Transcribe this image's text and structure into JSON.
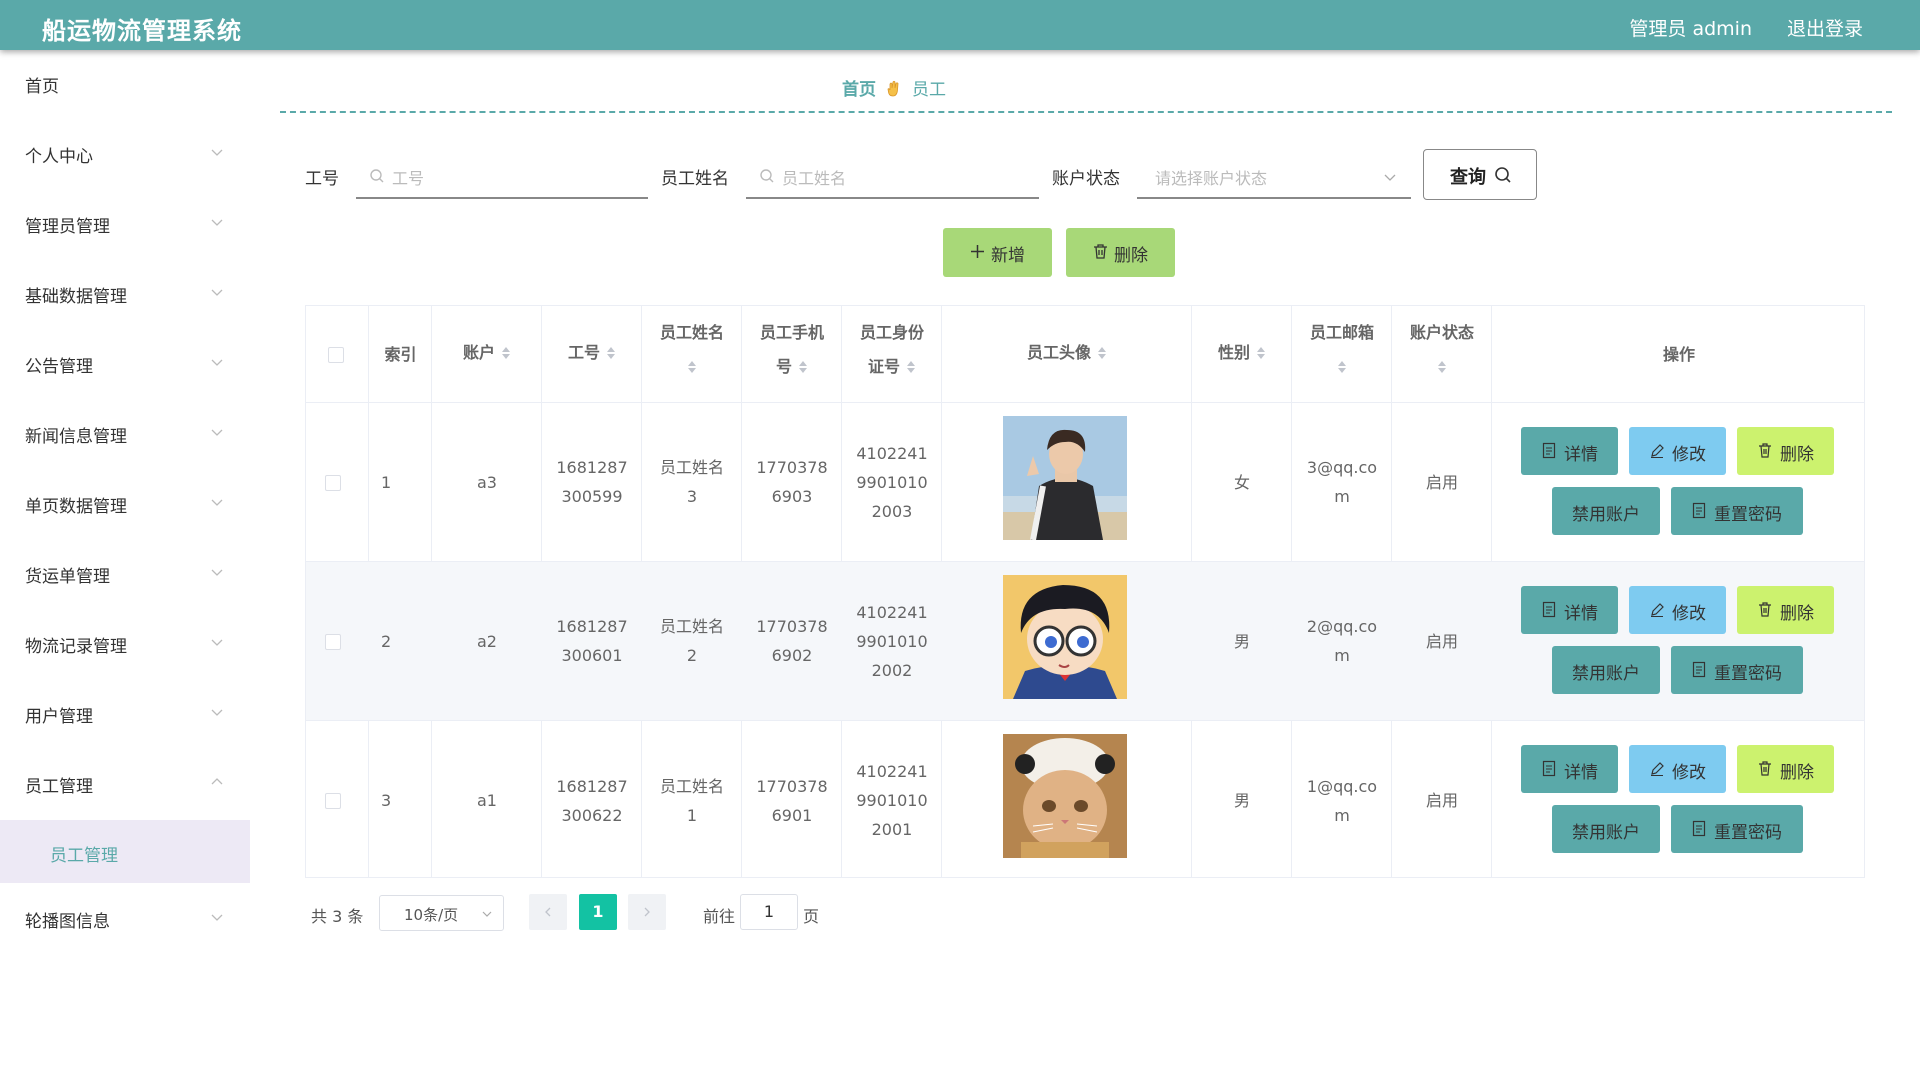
{
  "header": {
    "app_title": "船运物流管理系统",
    "user_label": "管理员 admin",
    "logout_label": "退出登录"
  },
  "sidebar": {
    "items": [
      {
        "label": "首页"
      },
      {
        "label": "个人中心"
      },
      {
        "label": "管理员管理"
      },
      {
        "label": "基础数据管理"
      },
      {
        "label": "公告管理"
      },
      {
        "label": "新闻信息管理"
      },
      {
        "label": "单页数据管理"
      },
      {
        "label": "货运单管理"
      },
      {
        "label": "物流记录管理"
      },
      {
        "label": "用户管理"
      },
      {
        "label": "员工管理"
      },
      {
        "label": "轮播图信息"
      }
    ],
    "active_sub_label": "员工管理"
  },
  "breadcrumb": {
    "home": "首页",
    "current": "员工"
  },
  "search": {
    "field1_label": "工号",
    "field1_placeholder": "工号",
    "field2_label": "员工姓名",
    "field2_placeholder": "员工姓名",
    "field3_label": "账户状态",
    "field3_placeholder": "请选择账户状态",
    "query_label": "查询"
  },
  "actions": {
    "add_label": "新增",
    "delete_label": "删除"
  },
  "table": {
    "headers": {
      "index": "索引",
      "account": "账户",
      "emp_no": "工号",
      "name_l1": "员工姓名",
      "phone_l1": "员工手机",
      "phone_l2": "号",
      "id_l1": "员工身份",
      "id_l2": "证号",
      "avatar": "员工头像",
      "gender": "性别",
      "email_l1": "员工邮箱",
      "status_l1": "账户状态",
      "ops": "操作"
    },
    "rows": [
      {
        "index": "1",
        "account": "a3",
        "emp_no_l1": "1681287",
        "emp_no_l2": "300599",
        "name_l1": "员工姓名",
        "name_l2": "3",
        "phone_l1": "1770378",
        "phone_l2": "6903",
        "id_l1": "4102241",
        "id_l2": "9901010",
        "id_l3": "2003",
        "gender": "女",
        "email_l1": "3@qq.co",
        "email_l2": "m",
        "status": "启用"
      },
      {
        "index": "2",
        "account": "a2",
        "emp_no_l1": "1681287",
        "emp_no_l2": "300601",
        "name_l1": "员工姓名",
        "name_l2": "2",
        "phone_l1": "1770378",
        "phone_l2": "6902",
        "id_l1": "4102241",
        "id_l2": "9901010",
        "id_l3": "2002",
        "gender": "男",
        "email_l1": "2@qq.co",
        "email_l2": "m",
        "status": "启用"
      },
      {
        "index": "3",
        "account": "a1",
        "emp_no_l1": "1681287",
        "emp_no_l2": "300622",
        "name_l1": "员工姓名",
        "name_l2": "1",
        "phone_l1": "1770378",
        "phone_l2": "6901",
        "id_l1": "4102241",
        "id_l2": "9901010",
        "id_l3": "2001",
        "gender": "男",
        "email_l1": "1@qq.co",
        "email_l2": "m",
        "status": "启用"
      }
    ],
    "op_labels": {
      "detail": "详情",
      "edit": "修改",
      "delete": "删除",
      "ban": "禁用账户",
      "reset": "重置密码"
    }
  },
  "pagination": {
    "total": "共 3 条",
    "page_size": "10条/页",
    "current_page": "1",
    "goto_label": "前往",
    "goto_value": "1",
    "page_suffix": "页"
  },
  "colors": {
    "primary": "#5aa9a9",
    "add_button": "#a8d878",
    "edit_button": "#7ecbf0",
    "delete_button": "#ccf26e",
    "active_page": "#13c2a3"
  }
}
